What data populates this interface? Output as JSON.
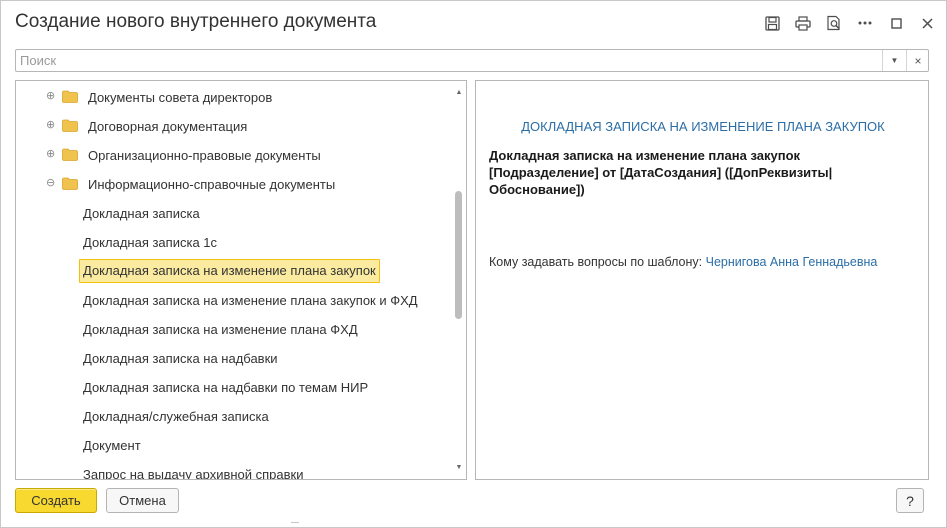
{
  "window": {
    "title": "Создание нового внутреннего документа",
    "controls": [
      "save-icon",
      "print-icon",
      "preview-icon",
      "more-icon",
      "maximize-icon",
      "close-icon"
    ]
  },
  "search": {
    "placeholder": "Поиск",
    "value": "",
    "dropdown_glyph": "▼",
    "clear_glyph": "×"
  },
  "tree": {
    "groups": [
      {
        "label": "Документы совета директоров",
        "expander": "⊕"
      },
      {
        "label": "Договорная документация",
        "expander": "⊕"
      },
      {
        "label": "Организационно-правовые документы",
        "expander": "⊕"
      },
      {
        "label": "Информационно-справочные документы",
        "expander": "⊖"
      }
    ],
    "items": [
      {
        "label": "Докладная записка"
      },
      {
        "label": "Докладная записка 1с"
      },
      {
        "label": "Докладная записка на изменение плана закупок",
        "selected": true
      },
      {
        "label": "Докладная записка на изменение плана закупок и ФХД"
      },
      {
        "label": "Докладная записка на изменение плана ФХД"
      },
      {
        "label": "Докладная записка на надбавки"
      },
      {
        "label": "Докладная записка на надбавки по темам НИР"
      },
      {
        "label": "Докладная/служебная записка"
      },
      {
        "label": "Документ"
      },
      {
        "label": "Запрос на выдачу архивной справки"
      }
    ],
    "scroll_up_glyph": "▲",
    "scroll_down_glyph": "▼"
  },
  "preview": {
    "heading": "ДОКЛАДНАЯ ЗАПИСКА НА ИЗМЕНЕНИЕ ПЛАНА ЗАКУПОК",
    "body": "Докладная записка на изменение плана закупок [Подразделение] от [ДатаСоздания] ([ДопРеквизиты| Обоснование])",
    "questions_label": "Кому задавать вопросы по шаблону:",
    "questions_contact": "Чернигова Анна Геннадьевна"
  },
  "buttons": {
    "create": "Создать",
    "cancel": "Отмена",
    "help": "?"
  },
  "colors": {
    "accent_yellow": "#f8d92f",
    "selection_fill": "#fbeba0",
    "selection_border": "#f2c00f",
    "link_blue": "#2b6ea6",
    "folder": "#f0c24e"
  }
}
